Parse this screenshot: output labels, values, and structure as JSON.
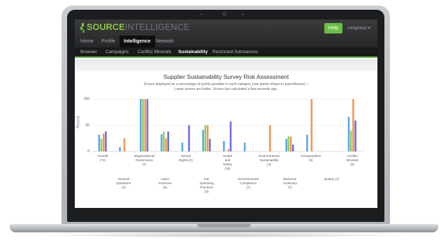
{
  "app": {
    "logo": {
      "part1": "SOURCE",
      "part2": "INTELLIGENCE"
    },
    "help_label": "Help",
    "user_label": "v44global ▾",
    "main_nav": [
      {
        "label": "Home"
      },
      {
        "label": "Profile"
      },
      {
        "label": "Intelligence",
        "active": true
      },
      {
        "label": "Network"
      }
    ],
    "sub_nav": [
      {
        "label": "Browser"
      },
      {
        "label": "Campaigns"
      },
      {
        "label": "Conflict Minerals"
      },
      {
        "label": "Sustainability",
        "active": true
      },
      {
        "label": "Restricted Substances"
      }
    ]
  },
  "report": {
    "title": "Supplier Sustainability Survey Risk Assessment",
    "subtitle_line1": "Scores displayed as a percentage of points possible in each category (raw points shown in parentheses). ¹",
    "subtitle_line2": "Lower scores are better. Scores last calculated a few seconds ago."
  },
  "colors": {
    "accent_green": "#6abf45",
    "series": [
      "#5aa9e6",
      "#8dd35f",
      "#f5964f",
      "#6f6ee0"
    ]
  },
  "chart_data": {
    "type": "bar",
    "ylabel": "Percent",
    "ylim": [
      0,
      100
    ],
    "yticks": [
      0,
      50,
      100
    ],
    "categories": [
      "Overall (71)",
      "General Questions (4)",
      "Organizational Governance (7)",
      "Labor Practices (8)",
      "Human Rights (2)",
      "Fair Operating Practices (4)",
      "Health and Safety (19)",
      "Environmental Compliance (7)",
      "Environmental Sustainability (4)",
      "Business Continuity (7)",
      "Transportation (3)",
      "Quality (1)",
      "Conflict Minerals (5)"
    ],
    "category_lines": [
      [
        "Overall",
        "(71)"
      ],
      [
        "General",
        "Questions",
        "(4)"
      ],
      [
        "Organizational",
        "Governance",
        "(7)"
      ],
      [
        "Labor",
        "Practices",
        "(8)"
      ],
      [
        "Human",
        "Rights (2)"
      ],
      [
        "Fair",
        "Operating",
        "Practices",
        "(4)"
      ],
      [
        "Health",
        "and",
        "Safety",
        "(19)"
      ],
      [
        "Environmental",
        "Compliance",
        "(7)"
      ],
      [
        "Environmental",
        "Sustainability",
        "(4)"
      ],
      [
        "Business",
        "Continuity",
        "(7)"
      ],
      [
        "Transportation",
        "(3)"
      ],
      [
        "Quality (1)"
      ],
      [
        "Conflict",
        "Minerals",
        "(5)"
      ]
    ],
    "series": [
      {
        "values": [
          32,
          8,
          100,
          33,
          17,
          41,
          20,
          17,
          0,
          24,
          32,
          0,
          66
        ]
      },
      {
        "values": [
          24,
          0,
          100,
          38,
          0,
          50,
          0,
          0,
          0,
          29,
          0,
          0,
          40
        ]
      },
      {
        "values": [
          34,
          25,
          100,
          25,
          0,
          50,
          4,
          0,
          50,
          28,
          100,
          0,
          100
        ]
      },
      {
        "values": [
          38,
          0,
          100,
          38,
          50,
          24,
          57,
          0,
          0,
          13,
          0,
          0,
          59
        ]
      }
    ]
  }
}
